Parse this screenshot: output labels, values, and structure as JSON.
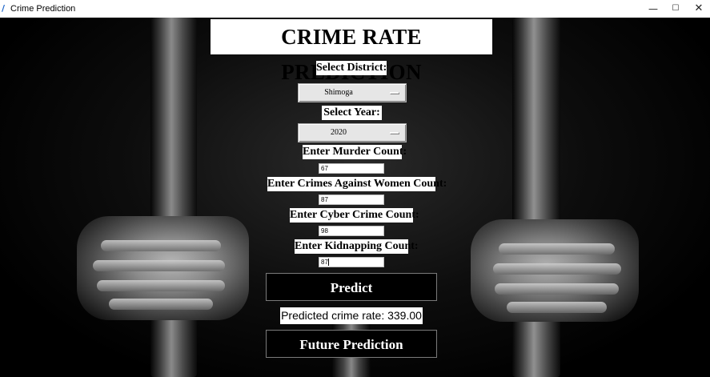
{
  "window": {
    "title": "Crime Prediction",
    "icon_char": "/",
    "minimize_glyph": "—",
    "maximize_glyph": "☐",
    "close_glyph": "✕"
  },
  "app": {
    "heading": "CRIME RATE PREDICTION"
  },
  "form": {
    "district": {
      "label": "Select District:",
      "value": "Shimoga"
    },
    "year": {
      "label": "Select Year:",
      "value": "2020"
    },
    "murder": {
      "label": "Enter Murder Count:",
      "value": "67"
    },
    "women": {
      "label": "Enter Crimes Against Women Count:",
      "value": "87"
    },
    "cyber": {
      "label": "Enter Cyber Crime Count:",
      "value": "98"
    },
    "kidnapping": {
      "label": "Enter Kidnapping Count:",
      "value": "87"
    }
  },
  "actions": {
    "predict_label": "Predict",
    "future_label": "Future Prediction"
  },
  "result": {
    "text": "Predicted crime rate: 339.00"
  },
  "colors": {
    "background": "#000000",
    "label_bg": "#ffffff",
    "button_bg": "#000000",
    "button_text": "#ffffff"
  }
}
